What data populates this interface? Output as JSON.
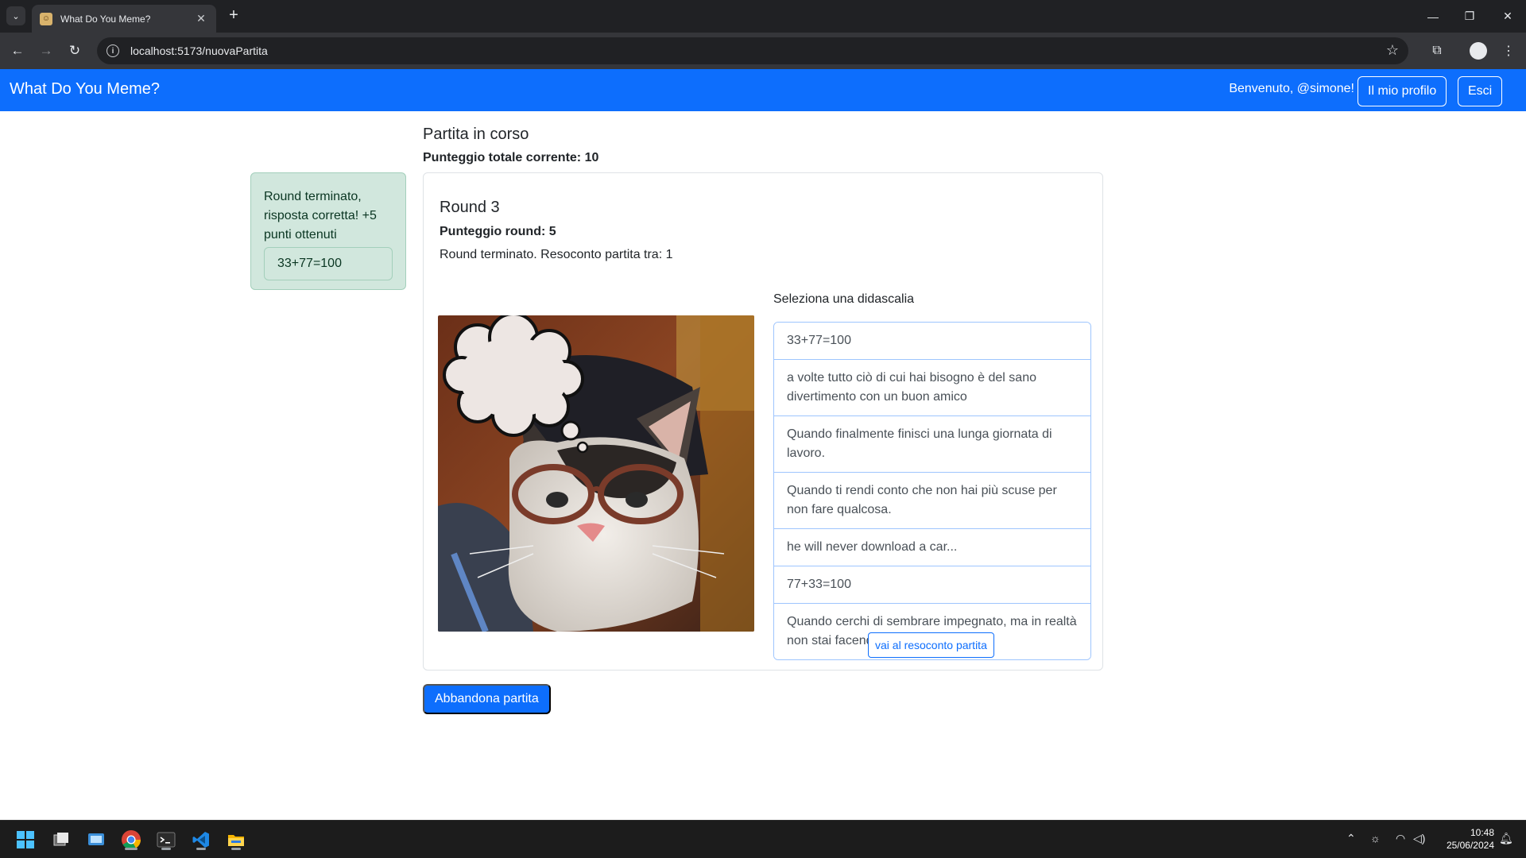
{
  "browser": {
    "tab_title": "What Do You Meme?",
    "url": "localhost:5173/nuovaPartita"
  },
  "navbar": {
    "brand": "What Do You Meme?",
    "welcome": "Benvenuto, @simone!",
    "profile_button": "Il mio profilo",
    "logout_button": "Esci",
    "color": "#0d6efd"
  },
  "game": {
    "title": "Partita in corso",
    "total_score": "Punteggio totale corrente: 10",
    "abandon_button": "Abbandona partita"
  },
  "alert": {
    "message": "Round terminato, risposta corretta! +5 punti ottenuti",
    "caption": "33+77=100",
    "color": "#d1e7dd"
  },
  "round": {
    "title": "Round 3",
    "score": "Punteggio round: 5",
    "status": "Round terminato. Resoconto partita tra: 1",
    "choose_label": "Seleziona una didascalia",
    "captions": [
      "33+77=100",
      "a volte tutto ciò di cui hai bisogno è del sano divertimento con un buon amico",
      "Quando finalmente finisci una lunga giornata di lavoro.",
      "Quando ti rendi conto che non hai più scuse per non fare qualcosa.",
      "he will never download a car...",
      "77+33=100",
      "Quando cerchi di sembrare impegnato, ma in realtà non stai facendo nulla."
    ],
    "summary_button": "vai al resoconto partita"
  },
  "taskbar": {
    "time": "10:48",
    "date": "25/06/2024"
  }
}
